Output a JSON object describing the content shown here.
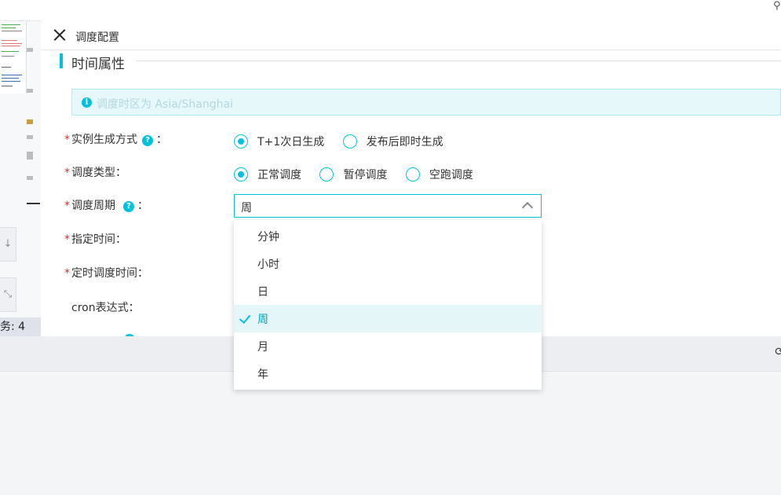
{
  "panel": {
    "title": "调度配置"
  },
  "section": {
    "title": "时间属性"
  },
  "tip": {
    "text": "调度时区为 Asia/Shanghai"
  },
  "fields": {
    "instance_mode": {
      "label": "实例生成方式",
      "options": [
        "T+1次日生成",
        "发布后即时生成"
      ],
      "selected": "T+1次日生成"
    },
    "schedule_type": {
      "label": "调度类型",
      "options": [
        "正常调度",
        "暂停调度",
        "空跑调度"
      ],
      "selected": "正常调度"
    },
    "schedule_cycle": {
      "label": "调度周期",
      "value": "周"
    },
    "specified_time": {
      "label": "指定时间"
    },
    "timed_schedule_time": {
      "label": "定时调度时间"
    },
    "cron": {
      "label": "cron表达式"
    }
  },
  "colon": "：",
  "dropdown": {
    "items": [
      "分钟",
      "小时",
      "日",
      "周",
      "月",
      "年"
    ],
    "selected": "周"
  },
  "left": {
    "count_text": "务: 4"
  },
  "icons": {
    "close": "close-icon",
    "info": "info-icon",
    "help": "help-icon",
    "chevron": "chevron-up-icon",
    "check": "check-icon"
  },
  "colors": {
    "accent": "#00c1de",
    "required": "#e72a2a",
    "selected_bg": "#e5f6f9"
  }
}
